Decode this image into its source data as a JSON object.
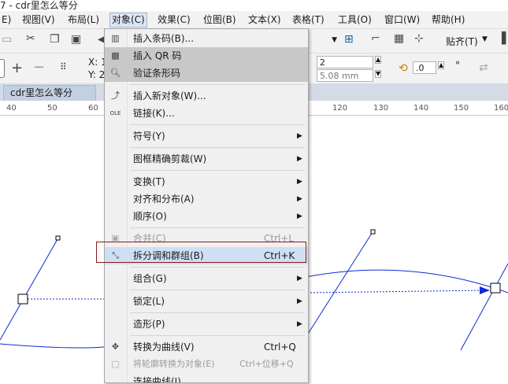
{
  "window": {
    "title": "7 - cdr里怎么等分"
  },
  "menubar": {
    "items": [
      "E)",
      "视图(V)",
      "布局(L)",
      "对象(C)",
      "效果(C)",
      "位图(B)",
      "文本(X)",
      "表格(T)",
      "工具(O)",
      "窗口(W)",
      "帮助(H)"
    ]
  },
  "toolbar": {
    "align_label": "贴齐(T)",
    "x_label": "X: 1",
    "y_label": "Y: 2",
    "spin_value": "2",
    "size_value": "5.08 mm",
    "angle_value": ".0",
    "degree_label": "°"
  },
  "doc_tab": {
    "label": "cdr里怎么等分"
  },
  "ruler": {
    "ticks": [
      "40",
      "50",
      "60",
      "120",
      "130",
      "140",
      "150",
      "160"
    ]
  },
  "object_menu": {
    "items": [
      {
        "label": "插入条码(B)...",
        "shortcut": "",
        "submenu": false,
        "disabled": false,
        "icon": "barcode-icon"
      },
      {
        "label": "插入 QR 码",
        "shortcut": "",
        "submenu": false,
        "disabled": false,
        "icon": "qr-code-icon"
      },
      {
        "label": "验证条形码",
        "shortcut": "",
        "submenu": false,
        "disabled": false,
        "icon": "magnifier-icon"
      },
      {
        "label": "插入新对象(W)...",
        "shortcut": "",
        "submenu": false,
        "disabled": false,
        "icon": "insert-object-icon"
      },
      {
        "label": "链接(K)...",
        "shortcut": "",
        "submenu": false,
        "disabled": false,
        "icon": "ole-icon"
      },
      {
        "label": "符号(Y)",
        "shortcut": "",
        "submenu": true,
        "disabled": false,
        "icon": ""
      },
      {
        "label": "图框精确剪裁(W)",
        "shortcut": "",
        "submenu": true,
        "disabled": false,
        "icon": ""
      },
      {
        "label": "变换(T)",
        "shortcut": "",
        "submenu": true,
        "disabled": false,
        "icon": ""
      },
      {
        "label": "对齐和分布(A)",
        "shortcut": "",
        "submenu": true,
        "disabled": false,
        "icon": ""
      },
      {
        "label": "顺序(O)",
        "shortcut": "",
        "submenu": true,
        "disabled": false,
        "icon": ""
      },
      {
        "label": "合并(C)",
        "shortcut": "Ctrl+L",
        "submenu": false,
        "disabled": true,
        "icon": "combine-icon"
      },
      {
        "label": "拆分调和群组(B)",
        "shortcut": "Ctrl+K",
        "submenu": false,
        "disabled": false,
        "icon": "break-apart-icon"
      },
      {
        "label": "组合(G)",
        "shortcut": "",
        "submenu": true,
        "disabled": false,
        "icon": ""
      },
      {
        "label": "锁定(L)",
        "shortcut": "",
        "submenu": true,
        "disabled": false,
        "icon": ""
      },
      {
        "label": "造形(P)",
        "shortcut": "",
        "submenu": true,
        "disabled": false,
        "icon": ""
      },
      {
        "label": "转换为曲线(V)",
        "shortcut": "Ctrl+Q",
        "submenu": false,
        "disabled": false,
        "icon": "convert-curve-icon"
      },
      {
        "label": "将轮廓转换为对象(E)",
        "shortcut": "Ctrl+位移+Q",
        "submenu": false,
        "disabled": true,
        "icon": "outline-object-icon"
      },
      {
        "label": "连接曲线(J)",
        "shortcut": "",
        "submenu": false,
        "disabled": false,
        "icon": ""
      }
    ]
  },
  "colors": {
    "accent": "#0b2bd6",
    "highlight_box": "#8b1a1a"
  }
}
